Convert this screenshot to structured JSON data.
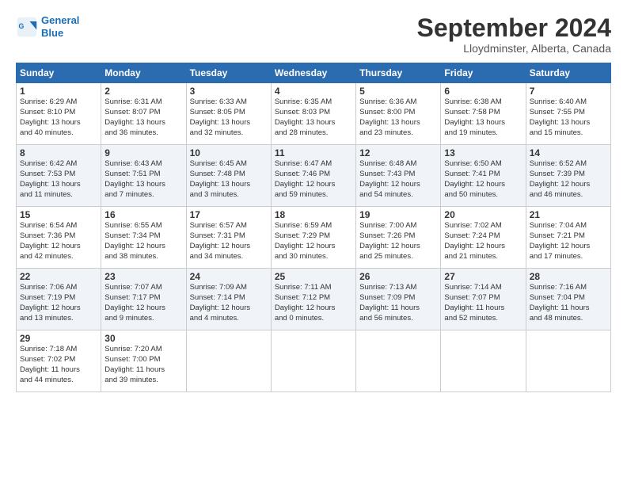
{
  "header": {
    "logo_line1": "General",
    "logo_line2": "Blue",
    "month": "September 2024",
    "location": "Lloydminster, Alberta, Canada"
  },
  "days_of_week": [
    "Sunday",
    "Monday",
    "Tuesday",
    "Wednesday",
    "Thursday",
    "Friday",
    "Saturday"
  ],
  "weeks": [
    [
      {
        "day": "1",
        "lines": [
          "Sunrise: 6:29 AM",
          "Sunset: 8:10 PM",
          "Daylight: 13 hours",
          "and 40 minutes."
        ]
      },
      {
        "day": "2",
        "lines": [
          "Sunrise: 6:31 AM",
          "Sunset: 8:07 PM",
          "Daylight: 13 hours",
          "and 36 minutes."
        ]
      },
      {
        "day": "3",
        "lines": [
          "Sunrise: 6:33 AM",
          "Sunset: 8:05 PM",
          "Daylight: 13 hours",
          "and 32 minutes."
        ]
      },
      {
        "day": "4",
        "lines": [
          "Sunrise: 6:35 AM",
          "Sunset: 8:03 PM",
          "Daylight: 13 hours",
          "and 28 minutes."
        ]
      },
      {
        "day": "5",
        "lines": [
          "Sunrise: 6:36 AM",
          "Sunset: 8:00 PM",
          "Daylight: 13 hours",
          "and 23 minutes."
        ]
      },
      {
        "day": "6",
        "lines": [
          "Sunrise: 6:38 AM",
          "Sunset: 7:58 PM",
          "Daylight: 13 hours",
          "and 19 minutes."
        ]
      },
      {
        "day": "7",
        "lines": [
          "Sunrise: 6:40 AM",
          "Sunset: 7:55 PM",
          "Daylight: 13 hours",
          "and 15 minutes."
        ]
      }
    ],
    [
      {
        "day": "8",
        "lines": [
          "Sunrise: 6:42 AM",
          "Sunset: 7:53 PM",
          "Daylight: 13 hours",
          "and 11 minutes."
        ]
      },
      {
        "day": "9",
        "lines": [
          "Sunrise: 6:43 AM",
          "Sunset: 7:51 PM",
          "Daylight: 13 hours",
          "and 7 minutes."
        ]
      },
      {
        "day": "10",
        "lines": [
          "Sunrise: 6:45 AM",
          "Sunset: 7:48 PM",
          "Daylight: 13 hours",
          "and 3 minutes."
        ]
      },
      {
        "day": "11",
        "lines": [
          "Sunrise: 6:47 AM",
          "Sunset: 7:46 PM",
          "Daylight: 12 hours",
          "and 59 minutes."
        ]
      },
      {
        "day": "12",
        "lines": [
          "Sunrise: 6:48 AM",
          "Sunset: 7:43 PM",
          "Daylight: 12 hours",
          "and 54 minutes."
        ]
      },
      {
        "day": "13",
        "lines": [
          "Sunrise: 6:50 AM",
          "Sunset: 7:41 PM",
          "Daylight: 12 hours",
          "and 50 minutes."
        ]
      },
      {
        "day": "14",
        "lines": [
          "Sunrise: 6:52 AM",
          "Sunset: 7:39 PM",
          "Daylight: 12 hours",
          "and 46 minutes."
        ]
      }
    ],
    [
      {
        "day": "15",
        "lines": [
          "Sunrise: 6:54 AM",
          "Sunset: 7:36 PM",
          "Daylight: 12 hours",
          "and 42 minutes."
        ]
      },
      {
        "day": "16",
        "lines": [
          "Sunrise: 6:55 AM",
          "Sunset: 7:34 PM",
          "Daylight: 12 hours",
          "and 38 minutes."
        ]
      },
      {
        "day": "17",
        "lines": [
          "Sunrise: 6:57 AM",
          "Sunset: 7:31 PM",
          "Daylight: 12 hours",
          "and 34 minutes."
        ]
      },
      {
        "day": "18",
        "lines": [
          "Sunrise: 6:59 AM",
          "Sunset: 7:29 PM",
          "Daylight: 12 hours",
          "and 30 minutes."
        ]
      },
      {
        "day": "19",
        "lines": [
          "Sunrise: 7:00 AM",
          "Sunset: 7:26 PM",
          "Daylight: 12 hours",
          "and 25 minutes."
        ]
      },
      {
        "day": "20",
        "lines": [
          "Sunrise: 7:02 AM",
          "Sunset: 7:24 PM",
          "Daylight: 12 hours",
          "and 21 minutes."
        ]
      },
      {
        "day": "21",
        "lines": [
          "Sunrise: 7:04 AM",
          "Sunset: 7:21 PM",
          "Daylight: 12 hours",
          "and 17 minutes."
        ]
      }
    ],
    [
      {
        "day": "22",
        "lines": [
          "Sunrise: 7:06 AM",
          "Sunset: 7:19 PM",
          "Daylight: 12 hours",
          "and 13 minutes."
        ]
      },
      {
        "day": "23",
        "lines": [
          "Sunrise: 7:07 AM",
          "Sunset: 7:17 PM",
          "Daylight: 12 hours",
          "and 9 minutes."
        ]
      },
      {
        "day": "24",
        "lines": [
          "Sunrise: 7:09 AM",
          "Sunset: 7:14 PM",
          "Daylight: 12 hours",
          "and 4 minutes."
        ]
      },
      {
        "day": "25",
        "lines": [
          "Sunrise: 7:11 AM",
          "Sunset: 7:12 PM",
          "Daylight: 12 hours",
          "and 0 minutes."
        ]
      },
      {
        "day": "26",
        "lines": [
          "Sunrise: 7:13 AM",
          "Sunset: 7:09 PM",
          "Daylight: 11 hours",
          "and 56 minutes."
        ]
      },
      {
        "day": "27",
        "lines": [
          "Sunrise: 7:14 AM",
          "Sunset: 7:07 PM",
          "Daylight: 11 hours",
          "and 52 minutes."
        ]
      },
      {
        "day": "28",
        "lines": [
          "Sunrise: 7:16 AM",
          "Sunset: 7:04 PM",
          "Daylight: 11 hours",
          "and 48 minutes."
        ]
      }
    ],
    [
      {
        "day": "29",
        "lines": [
          "Sunrise: 7:18 AM",
          "Sunset: 7:02 PM",
          "Daylight: 11 hours",
          "and 44 minutes."
        ]
      },
      {
        "day": "30",
        "lines": [
          "Sunrise: 7:20 AM",
          "Sunset: 7:00 PM",
          "Daylight: 11 hours",
          "and 39 minutes."
        ]
      },
      {
        "day": "",
        "lines": []
      },
      {
        "day": "",
        "lines": []
      },
      {
        "day": "",
        "lines": []
      },
      {
        "day": "",
        "lines": []
      },
      {
        "day": "",
        "lines": []
      }
    ]
  ]
}
